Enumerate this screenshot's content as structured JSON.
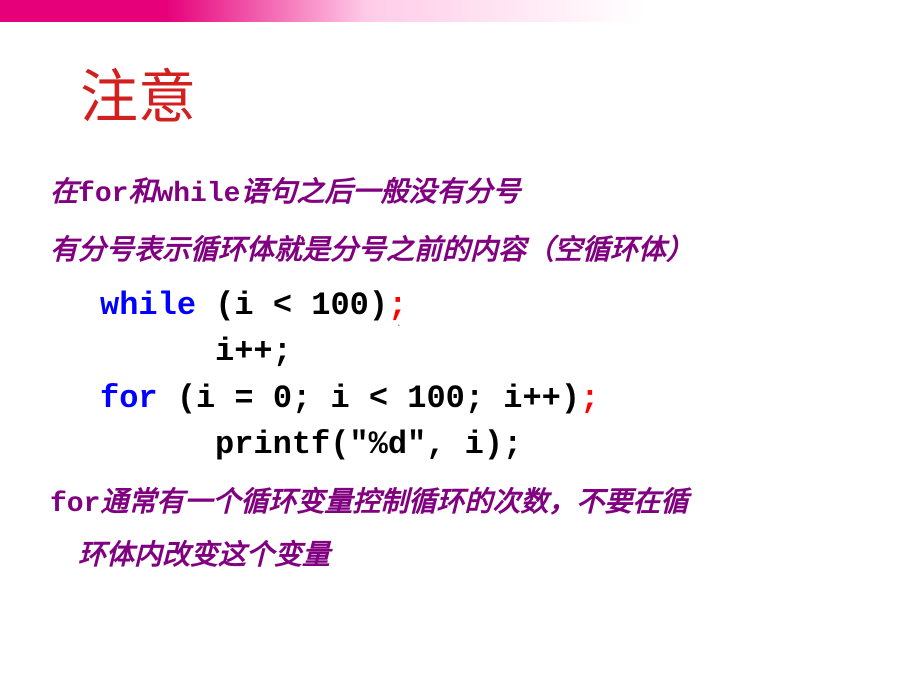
{
  "title": "注意",
  "paragraphs": {
    "p1_pre": "在",
    "p1_kw1": "for",
    "p1_mid": "和",
    "p1_kw2": "while",
    "p1_post": "语句之后一般没有分号",
    "p2": "有分号表示循环体就是分号之前的内容（空循环体）",
    "p3_kw": "for",
    "p3_text": "通常有一个循环变量控制循环的次数，不要在循",
    "p3_cont": "环体内改变这个变量"
  },
  "code": {
    "c1_kw": "while",
    "c1_rest": " (i < 100)",
    "c1_semi": ";",
    "c2": "i++;",
    "c3_kw": "for",
    "c3_rest": " (i = 0; i < 100; i++)",
    "c3_semi": ";",
    "c4": "printf(\"%d\", i);"
  },
  "marker": "."
}
